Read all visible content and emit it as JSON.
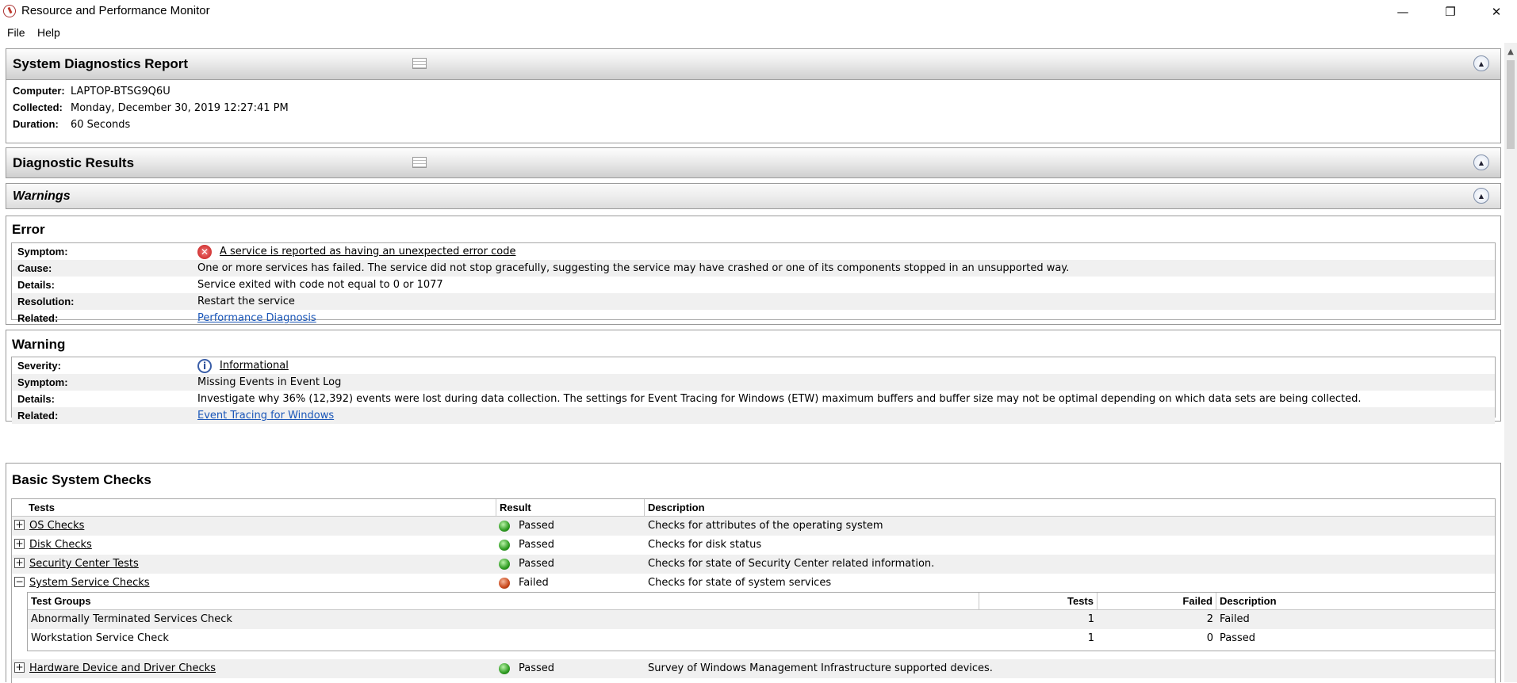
{
  "window": {
    "title": "Resource and Performance Monitor",
    "minimize": "—",
    "restore": "❐",
    "close": "✕"
  },
  "menu": {
    "file": "File",
    "help": "Help"
  },
  "report": {
    "title": "System Diagnostics Report",
    "computer_label": "Computer:",
    "computer": "LAPTOP-BTSG9Q6U",
    "collected_label": "Collected:",
    "collected": "Monday, December 30, 2019 12:27:41 PM",
    "duration_label": "Duration:",
    "duration": "60 Seconds"
  },
  "diagnostic_results": {
    "title": "Diagnostic Results"
  },
  "warnings": {
    "title": "Warnings"
  },
  "error": {
    "title": "Error",
    "symptom_label": "Symptom:",
    "symptom": "A service is reported as having an unexpected error code",
    "cause_label": "Cause:",
    "cause": "One or more services has failed. The service did not stop gracefully, suggesting the service may have crashed or one of its components stopped in an unsupported way.",
    "details_label": "Details:",
    "details": "Service exited with code not equal to 0 or 1077",
    "resolution_label": "Resolution:",
    "resolution": "Restart the service",
    "related_label": "Related:",
    "related": "Performance Diagnosis"
  },
  "warning": {
    "title": "Warning",
    "severity_label": "Severity:",
    "severity": "Informational",
    "symptom_label": "Symptom:",
    "symptom": "Missing Events in Event Log",
    "details_label": "Details:",
    "details": "Investigate why 36% (12,392) events were lost during data collection. The settings for Event Tracing for Windows (ETW) maximum buffers and buffer size may not be optimal depending on which data sets are being collected.",
    "related_label": "Related:",
    "related": "Event Tracing for Windows"
  },
  "basic_checks": {
    "title": "Basic System Checks",
    "columns": {
      "tests": "Tests",
      "result": "Result",
      "description": "Description"
    },
    "rows": [
      {
        "name": "OS Checks",
        "result": "Passed",
        "description": "Checks for attributes of the operating system"
      },
      {
        "name": "Disk Checks",
        "result": "Passed",
        "description": "Checks for disk status"
      },
      {
        "name": "Security Center Tests",
        "result": "Passed",
        "description": "Checks for state of Security Center related information."
      },
      {
        "name": "System Service Checks",
        "result": "Failed",
        "description": "Checks for state of system services"
      },
      {
        "name": "Hardware Device and Driver Checks",
        "result": "Passed",
        "description": "Survey of Windows Management Infrastructure supported devices."
      }
    ],
    "subtable": {
      "columns": {
        "groups": "Test Groups",
        "tests": "Tests",
        "failed": "Failed",
        "description": "Description"
      },
      "rows": [
        {
          "name": "Abnormally Terminated Services Check",
          "tests": "1",
          "failed": "2",
          "description": "Failed"
        },
        {
          "name": "Workstation Service Check",
          "tests": "1",
          "failed": "0",
          "description": "Passed"
        }
      ]
    }
  },
  "expander": {
    "plus": "+",
    "minus": "−"
  },
  "colors": {
    "passed": "#2e9b21",
    "failed": "#c8471a",
    "link": "#1a56b8"
  }
}
